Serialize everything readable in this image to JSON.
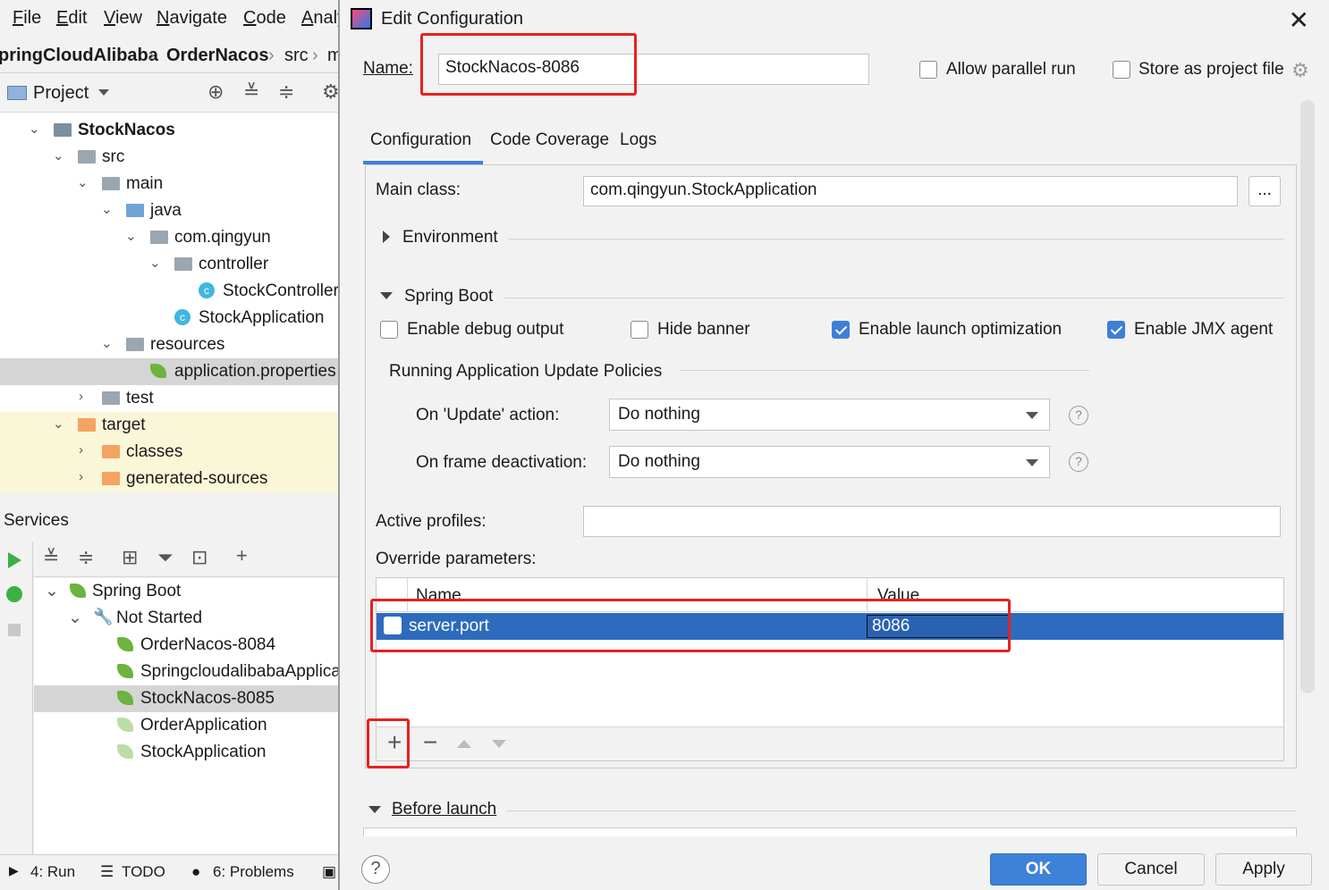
{
  "menu": [
    "File",
    "Edit",
    "View",
    "Navigate",
    "Code",
    "Analy"
  ],
  "breadcrumb": [
    "pringCloudAlibaba",
    "OrderNacos",
    "src",
    "m"
  ],
  "project_panel": {
    "label": "Project"
  },
  "tree": [
    {
      "label": "StockNacos",
      "bold": true
    },
    {
      "label": "src"
    },
    {
      "label": "main"
    },
    {
      "label": "java"
    },
    {
      "label": "com.qingyun"
    },
    {
      "label": "controller"
    },
    {
      "label": "StockController"
    },
    {
      "label": "StockApplication"
    },
    {
      "label": "resources"
    },
    {
      "label": "application.properties"
    },
    {
      "label": "test"
    },
    {
      "label": "target"
    },
    {
      "label": "classes"
    },
    {
      "label": "generated-sources"
    }
  ],
  "services": {
    "title": "Services",
    "items": [
      {
        "label": "Spring Boot"
      },
      {
        "label": "Not Started"
      },
      {
        "label": "OrderNacos-8084"
      },
      {
        "label": "SpringcloudalibabaApplication"
      },
      {
        "label": "StockNacos-8085"
      },
      {
        "label": "OrderApplication"
      },
      {
        "label": "StockApplication"
      }
    ]
  },
  "bottom_tabs": [
    "4: Run",
    "TODO",
    "6: Problems"
  ],
  "dialog": {
    "title": "Edit Configuration",
    "name_label": "Name:",
    "name_value": "StockNacos-8086",
    "allow_parallel": "Allow parallel run",
    "store_project": "Store as project file",
    "tabs": [
      "Configuration",
      "Code Coverage",
      "Logs"
    ],
    "main_class_label": "Main class:",
    "main_class_value": "com.qingyun.StockApplication",
    "browse": "...",
    "environment": "Environment",
    "spring_boot": "Spring Boot",
    "opt_debug": "Enable debug output",
    "opt_banner": "Hide banner",
    "opt_launch": "Enable launch optimization",
    "opt_jmx": "Enable JMX agent",
    "policies_title": "Running Application Update Policies",
    "update_label": "On 'Update' action:",
    "update_value": "Do nothing",
    "frame_label": "On frame deactivation:",
    "frame_value": "Do nothing",
    "help_mark": "?",
    "profiles_label": "Active profiles:",
    "profiles_value": "",
    "override_label": "Override parameters:",
    "col_name": "Name",
    "col_value": "Value",
    "param_name": "server.port",
    "param_value": "8086",
    "before_launch": "Before launch",
    "ok": "OK",
    "cancel": "Cancel",
    "apply": "Apply"
  },
  "colors": {
    "accent": "#3d7fd9",
    "highlight_box": "#e82020",
    "selected_row": "#2d6bbf"
  }
}
